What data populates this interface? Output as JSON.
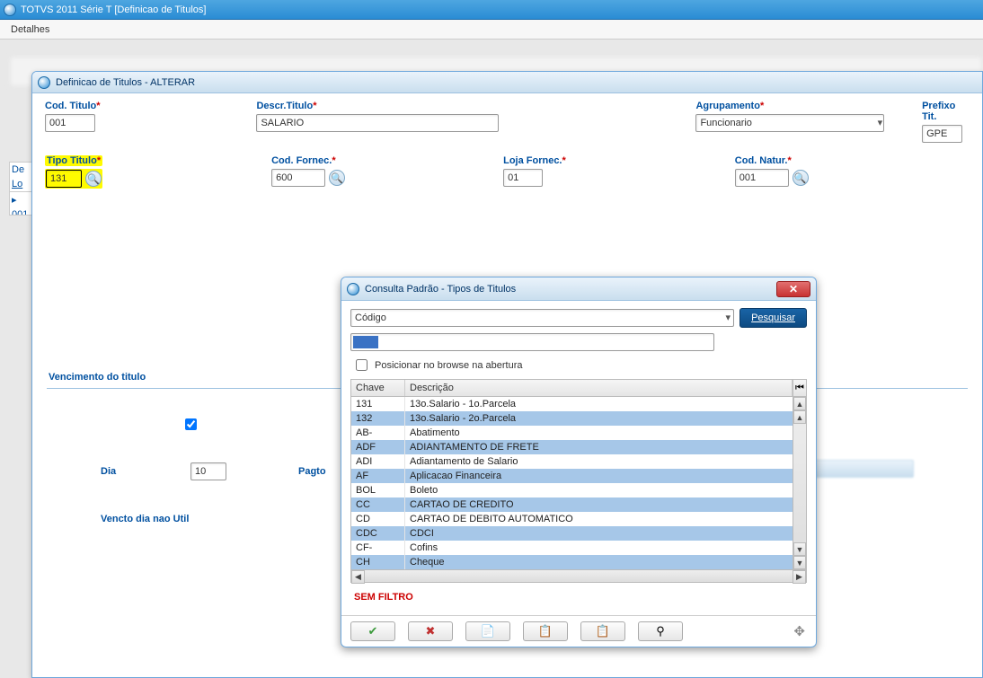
{
  "app": {
    "title": "TOTVS 2011 Série T  [Definicao de Titulos]",
    "menu": "Detalhes"
  },
  "left_stub": {
    "label1": "De",
    "label2": "Lo",
    "val": "001"
  },
  "window": {
    "title": "Definicao de Titulos - ALTERAR",
    "fields": {
      "cod_titulo": {
        "label": "Cod. Titulo",
        "value": "001"
      },
      "descr_titulo": {
        "label": "Descr.Titulo",
        "value": "SALARIO"
      },
      "agrupamento": {
        "label": "Agrupamento",
        "value": "Funcionario"
      },
      "prefixo": {
        "label": "Prefixo Tit.",
        "value": "GPE"
      },
      "tipo_titulo": {
        "label": "Tipo Titulo",
        "value": "131"
      },
      "cod_fornec": {
        "label": "Cod. Fornec.",
        "value": "600"
      },
      "loja_fornec": {
        "label": "Loja Fornec.",
        "value": "01"
      },
      "cod_natur": {
        "label": "Cod. Natur.",
        "value": "001"
      }
    },
    "section": {
      "title": "Vencimento do titulo",
      "dia_label": "Dia",
      "dia_value": "10",
      "pagto_label": "Pagto",
      "vencto_text": "Vencto dia nao Util"
    }
  },
  "modal": {
    "title": "Consulta Padrão - Tipos de Titulos",
    "search_field": "Código",
    "search_btn": "Pesquisar",
    "search_value": " ",
    "posicionar_label": "Posicionar no browse na abertura",
    "col_chave": "Chave",
    "col_descricao": "Descrição",
    "rows": [
      {
        "chave": "131",
        "desc": "13o.Salario - 1o.Parcela"
      },
      {
        "chave": "132",
        "desc": "13o.Salario - 2o.Parcela"
      },
      {
        "chave": "AB-",
        "desc": "Abatimento"
      },
      {
        "chave": "ADF",
        "desc": "ADIANTAMENTO DE FRETE"
      },
      {
        "chave": "ADI",
        "desc": "Adiantamento de Salario"
      },
      {
        "chave": "AF",
        "desc": "Aplicacao Financeira"
      },
      {
        "chave": "BOL",
        "desc": "Boleto"
      },
      {
        "chave": "CC",
        "desc": "CARTAO DE CREDITO"
      },
      {
        "chave": "CD",
        "desc": "CARTAO DE DEBITO AUTOMATICO"
      },
      {
        "chave": "CDC",
        "desc": "CDCI"
      },
      {
        "chave": "CF-",
        "desc": "Cofins"
      },
      {
        "chave": "CH",
        "desc": "Cheque"
      }
    ],
    "sem_filtro": "SEM FILTRO"
  }
}
